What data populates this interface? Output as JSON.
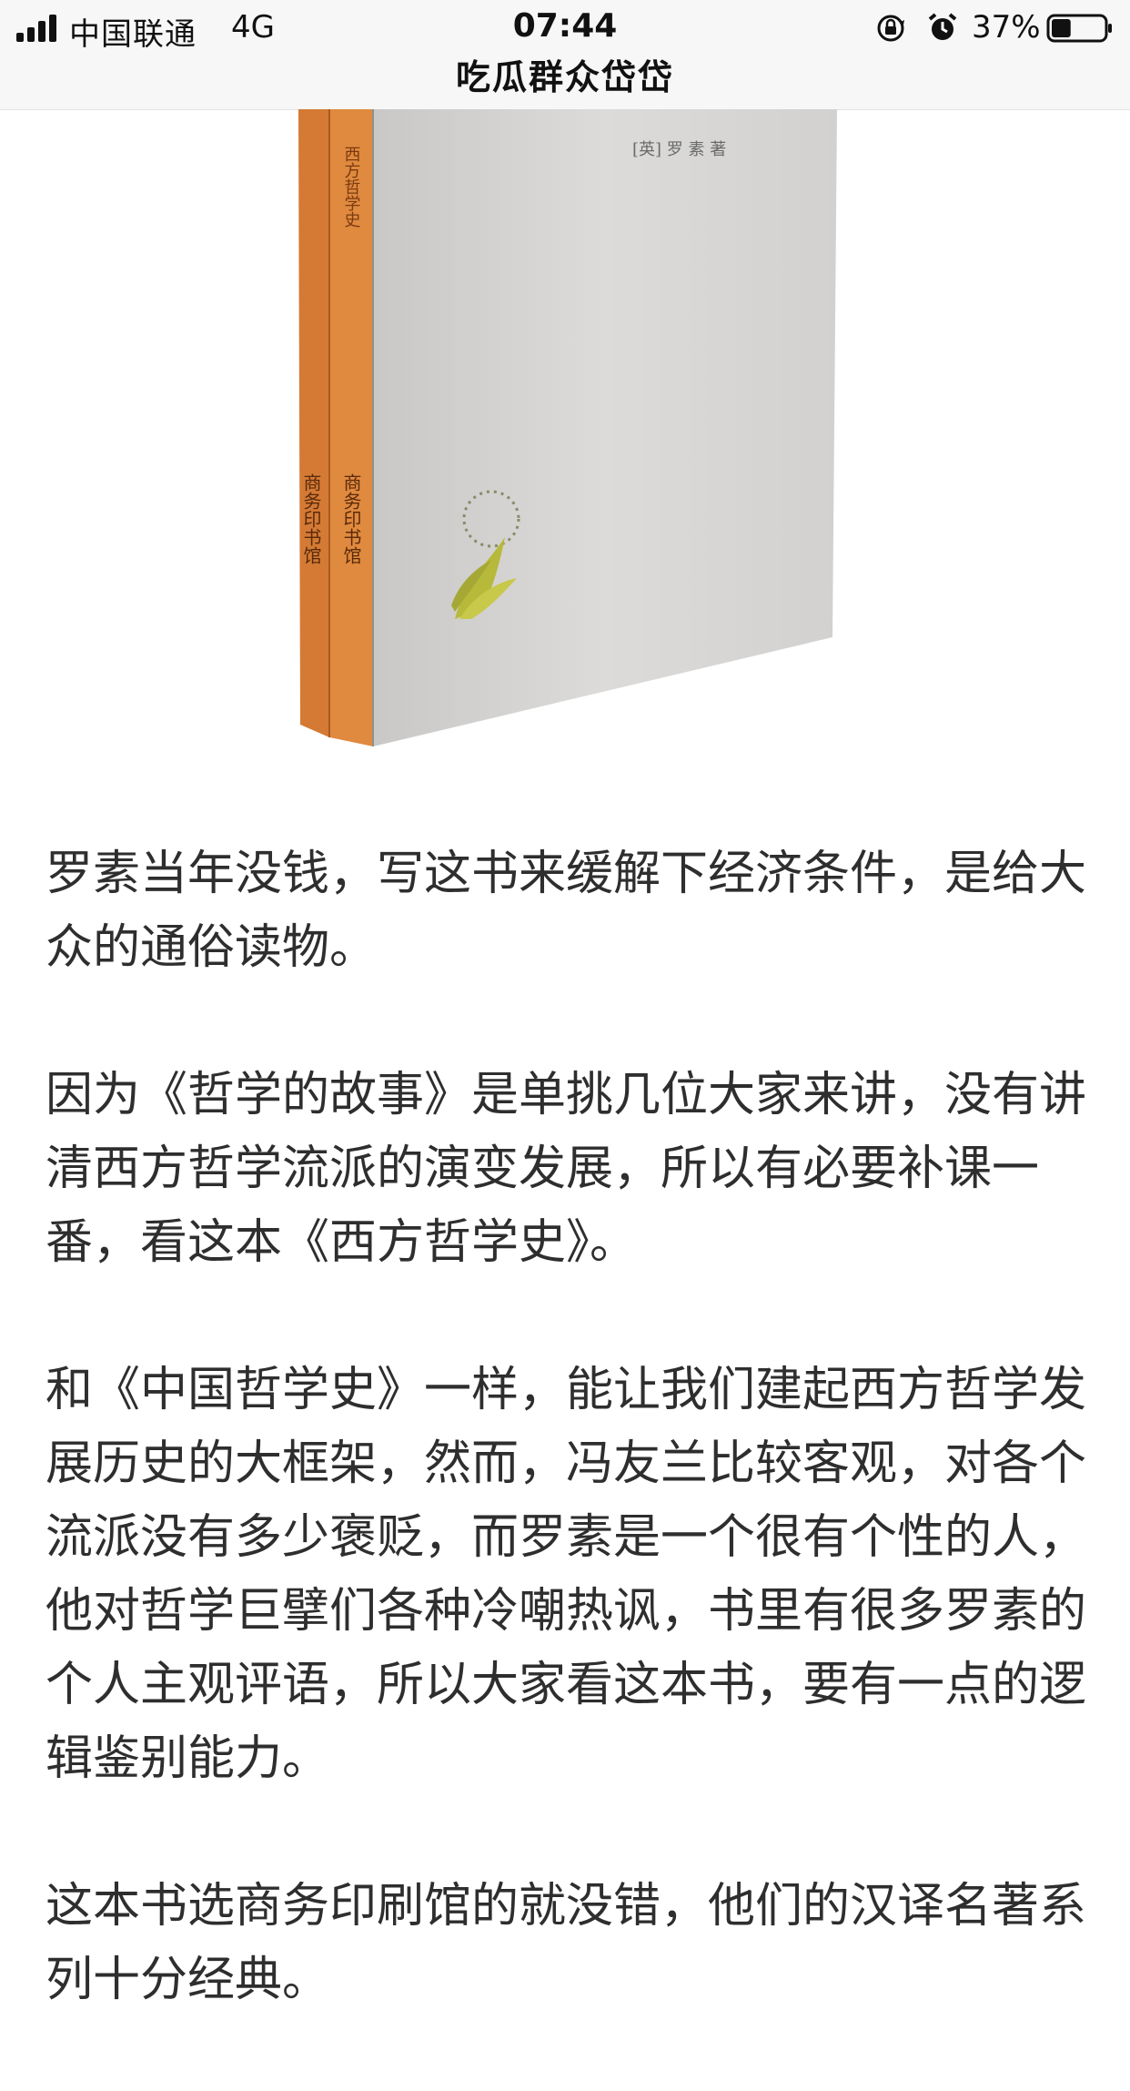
{
  "status_bar": {
    "carrier": "中国联通",
    "network": "4G",
    "time": "07:44",
    "battery": "37%",
    "battery_level": 0.37
  },
  "header": {
    "title": "吃瓜群众岱岱"
  },
  "book": {
    "cover_text_author": "[英] 罗 素 著",
    "spine_text": "西方哲学史",
    "publisher_text": "商务印书馆"
  },
  "article": {
    "paragraphs": [
      "罗素当年没钱，写这书来缓解下经济条件，是给大众的通俗读物。",
      "因为《哲学的故事》是单挑几位大家来讲，没有讲清西方哲学流派的演变发展，所以有必要补课一番，看这本《西方哲学史》。",
      "和《中国哲学史》一样，能让我们建起西方哲学发展历史的大框架，然而，冯友兰比较客观，对各个流派没有多少褒贬，而罗素是一个很有个性的人，他对哲学巨擘们各种冷嘲热讽，书里有很多罗素的个人主观评语，所以大家看这本书，要有一点的逻辑鉴别能力。",
      "这本书选商务印刷馆的就没错，他们的汉译名著系列十分经典。"
    ]
  }
}
